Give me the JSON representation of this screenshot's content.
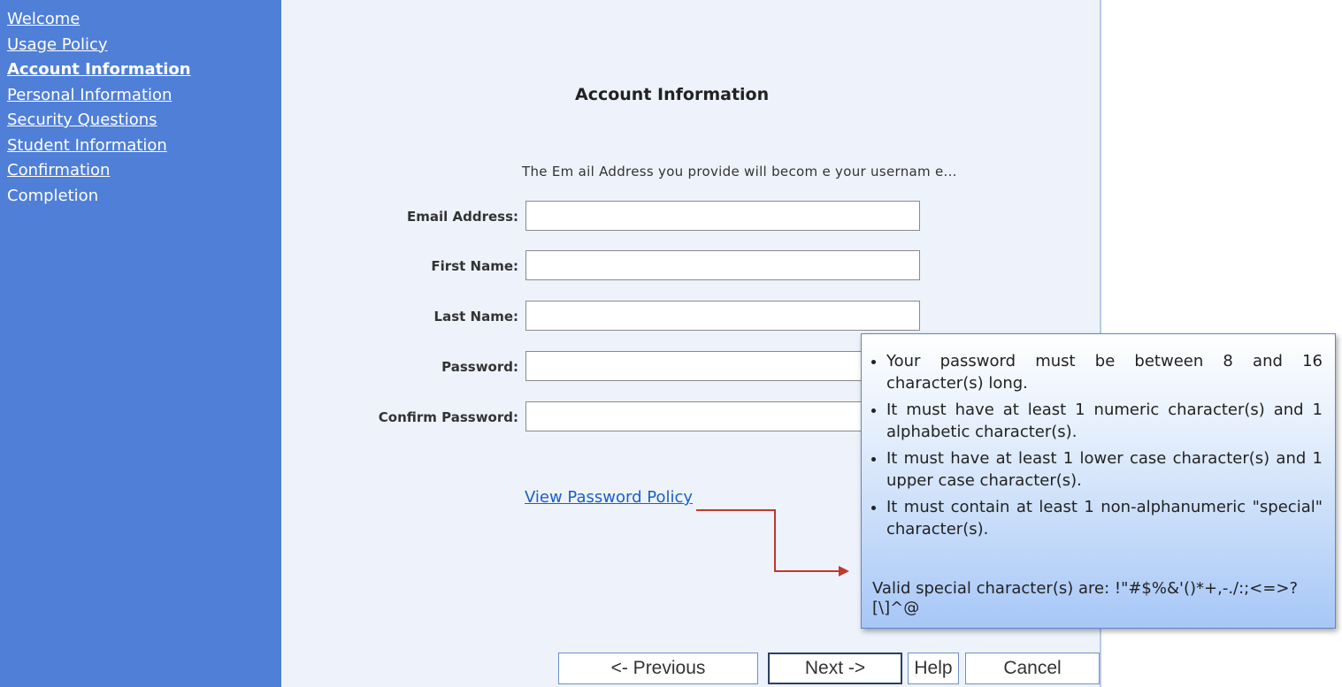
{
  "sidebar": {
    "items": [
      {
        "label": "Welcome"
      },
      {
        "label": "Usage Policy"
      },
      {
        "label": "Account Information"
      },
      {
        "label": "Personal Information"
      },
      {
        "label": "Security Questions"
      },
      {
        "label": "Student Information"
      },
      {
        "label": "Confirmation"
      },
      {
        "label": "Completion"
      }
    ]
  },
  "main": {
    "title": "Account Information",
    "intro": "The Em ail Address you provide will becom e your usernam e...",
    "fields": {
      "email": {
        "label": "Email Address:",
        "value": ""
      },
      "first_name": {
        "label": "First Name:",
        "value": ""
      },
      "last_name": {
        "label": "Last Name:",
        "value": ""
      },
      "password": {
        "label": "Password:",
        "value": ""
      },
      "confirm_password": {
        "label": "Confirm Password:",
        "value": ""
      }
    },
    "policy_link": "View Password Policy"
  },
  "tooltip": {
    "rules": [
      "Your password must be between 8 and 16 character(s) long.",
      "It must have at least 1 numeric character(s) and 1 alphabetic character(s).",
      "It must have at least 1 lower case character(s) and 1 upper case character(s).",
      "It must contain at least 1 non-alphanumeric \"special\" character(s)."
    ],
    "valid_special": "Valid special character(s) are: !\"#$%&'()*+,-./:;<=>?[\\]^@"
  },
  "buttons": {
    "previous": "<- Previous",
    "next": "Next ->",
    "help": "Help",
    "cancel": "Cancel"
  },
  "colors": {
    "sidebar_bg": "#4f7fd6",
    "main_bg": "#eef3fb",
    "link": "#1a5fc8",
    "arrow": "#c0392b"
  }
}
